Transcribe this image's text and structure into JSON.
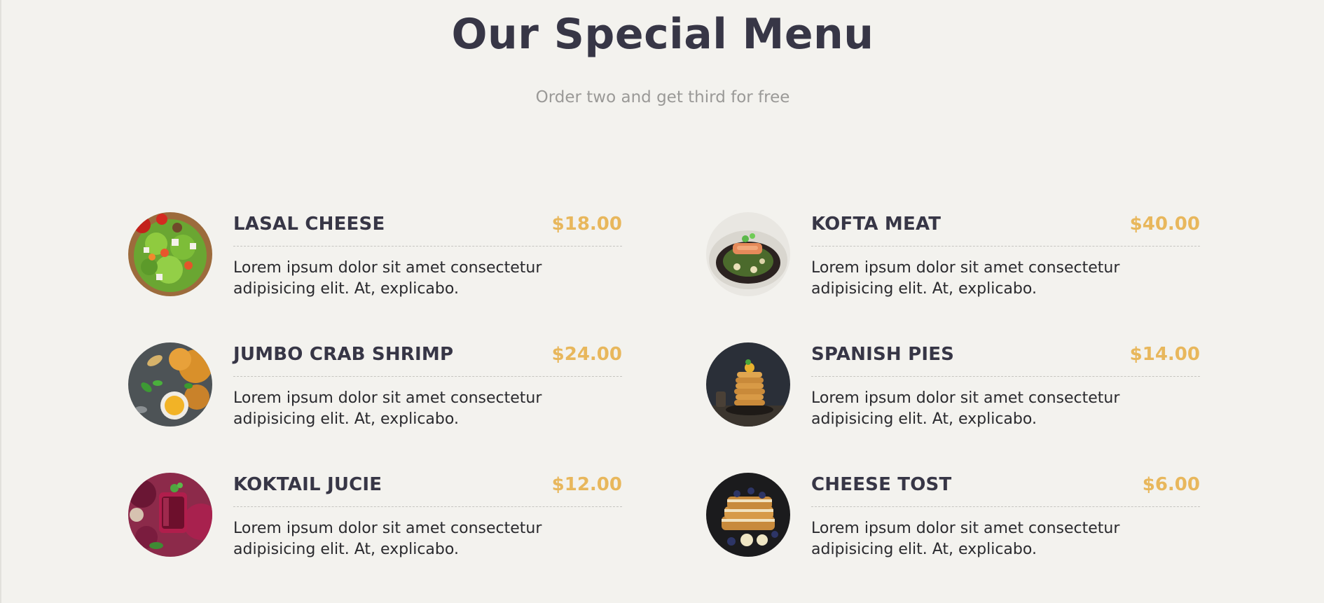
{
  "header": {
    "title": "Our Special Menu",
    "subtitle": "Order two and get third for free"
  },
  "colors": {
    "background": "#f3f2ee",
    "title": "#373646",
    "price": "#e8b75c",
    "subtitle": "#9a9997"
  },
  "menu": {
    "items": [
      {
        "name": "LASAL CHEESE",
        "price": "$18.00",
        "description": "Lorem ipsum dolor sit amet consectetur adipisicing elit. At, explicabo.",
        "image": "salad-image"
      },
      {
        "name": "KOFTA MEAT",
        "price": "$40.00",
        "description": "Lorem ipsum dolor sit amet consectetur adipisicing elit. At, explicabo.",
        "image": "salmon-dish-image"
      },
      {
        "name": "JUMBO CRAB SHRIMP",
        "price": "$24.00",
        "description": "Lorem ipsum dolor sit amet consectetur adipisicing elit. At, explicabo.",
        "image": "shrimp-platter-image"
      },
      {
        "name": "SPANISH PIES",
        "price": "$14.00",
        "description": "Lorem ipsum dolor sit amet consectetur adipisicing elit. At, explicabo.",
        "image": "pancake-stack-image"
      },
      {
        "name": "KOKTAIL JUCIE",
        "price": "$12.00",
        "description": "Lorem ipsum dolor sit amet consectetur adipisicing elit. At, explicabo.",
        "image": "beet-juice-image"
      },
      {
        "name": "CHEESE TOST",
        "price": "$6.00",
        "description": "Lorem ipsum dolor sit amet consectetur adipisicing elit. At, explicabo.",
        "image": "french-toast-image"
      }
    ]
  }
}
